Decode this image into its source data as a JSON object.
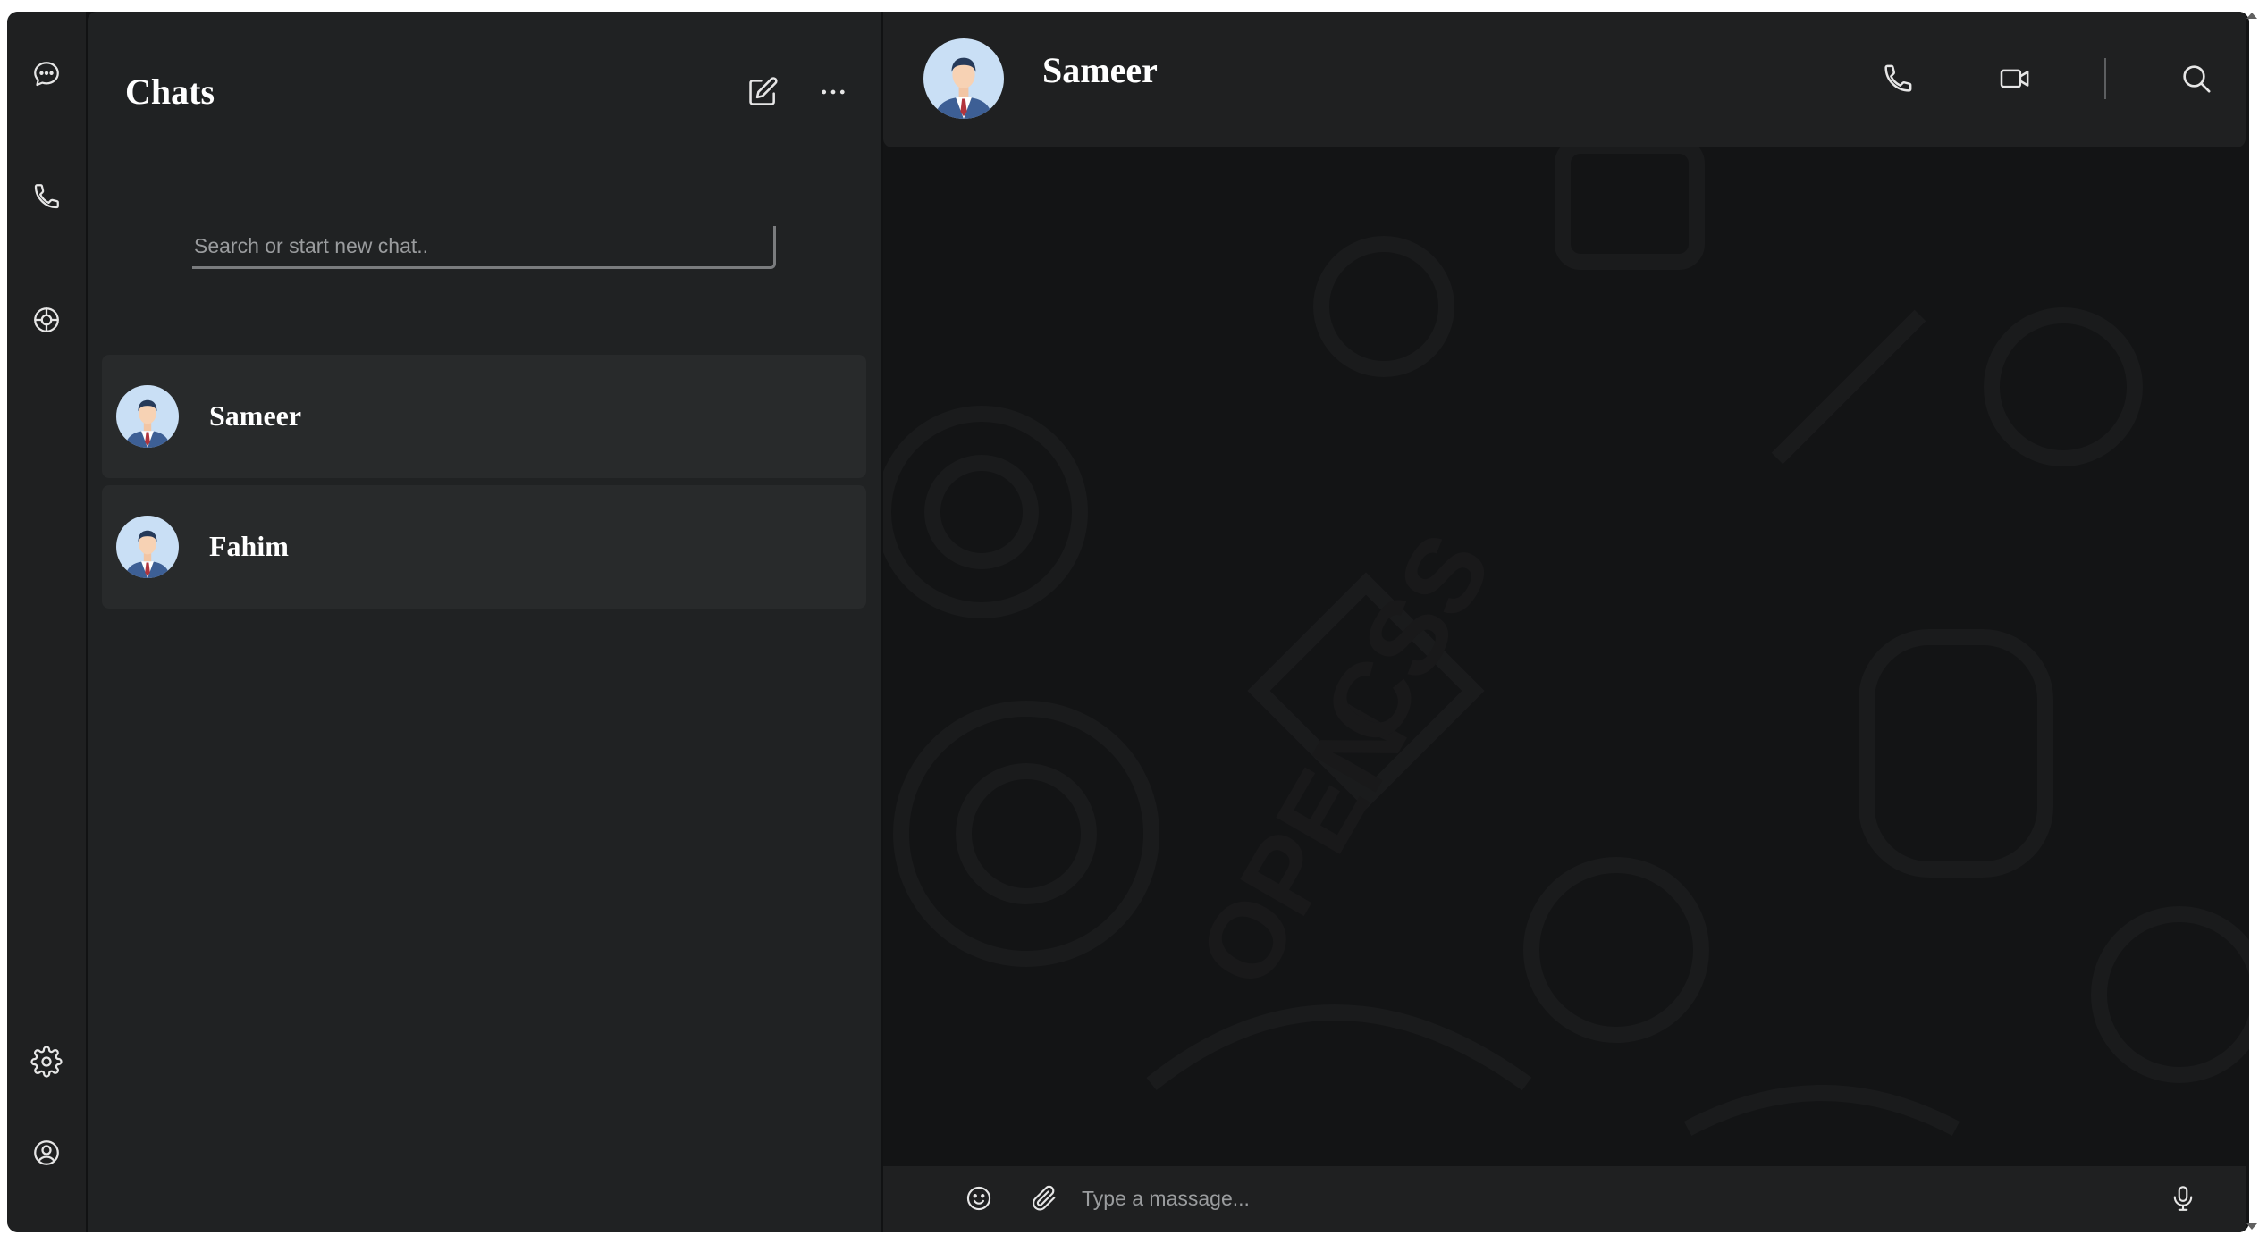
{
  "rail": {
    "items": [
      {
        "icon": "chat-bubble-icon"
      },
      {
        "icon": "phone-icon"
      },
      {
        "icon": "status-icon"
      },
      {
        "icon": "gear-icon"
      },
      {
        "icon": "user-circle-icon"
      }
    ]
  },
  "list": {
    "title": "Chats",
    "search_placeholder": "Search or start new chat..",
    "chats": [
      {
        "name": "Sameer"
      },
      {
        "name": "Fahim"
      }
    ]
  },
  "conversation": {
    "contact_name": "Sameer",
    "message_placeholder": "Type a massage..."
  },
  "colors": {
    "panel": "#202223",
    "rail": "#1f2021",
    "chat_item": "#282a2b",
    "background": "#131415",
    "icon": "#e6e6e6"
  }
}
